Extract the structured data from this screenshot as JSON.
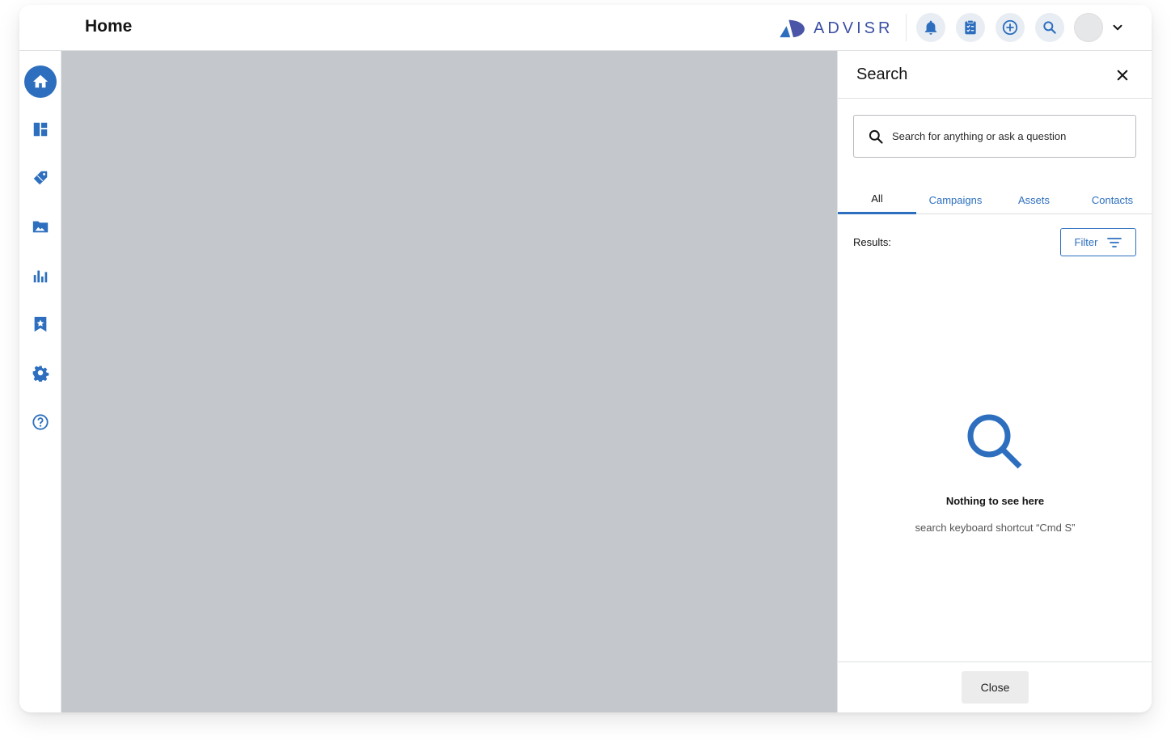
{
  "header": {
    "page_title": "Home",
    "brand_name": "ADVISR",
    "icons": [
      "notifications-icon",
      "tasks-clipboard-icon",
      "add-circle-icon",
      "search-icon",
      "avatar",
      "chevron-down-icon"
    ]
  },
  "sidebar": {
    "items": [
      {
        "name": "home",
        "icon": "home-icon",
        "active": true
      },
      {
        "name": "dashboard",
        "icon": "dashboard-icon"
      },
      {
        "name": "campaigns",
        "icon": "tag-icon"
      },
      {
        "name": "assets",
        "icon": "image-folder-icon"
      },
      {
        "name": "reports",
        "icon": "bar-chart-icon"
      },
      {
        "name": "favorites",
        "icon": "bookmark-star-icon"
      },
      {
        "name": "settings",
        "icon": "gear-icon"
      },
      {
        "name": "help",
        "icon": "help-circle-icon"
      }
    ]
  },
  "search_panel": {
    "title": "Search",
    "placeholder": "Search for anything or ask a question",
    "tabs": [
      "All",
      "Campaigns",
      "Assets",
      "Contacts"
    ],
    "active_tab": "All",
    "results_label": "Results:",
    "filter_label": "Filter",
    "empty_title": "Nothing to see here",
    "empty_subtitle": "search keyboard shortcut “Cmd S”",
    "close_label": "Close"
  },
  "colors": {
    "accent": "#2d6fbe",
    "brand": "#3b4fa3",
    "overlay": "#c4c7cc"
  }
}
